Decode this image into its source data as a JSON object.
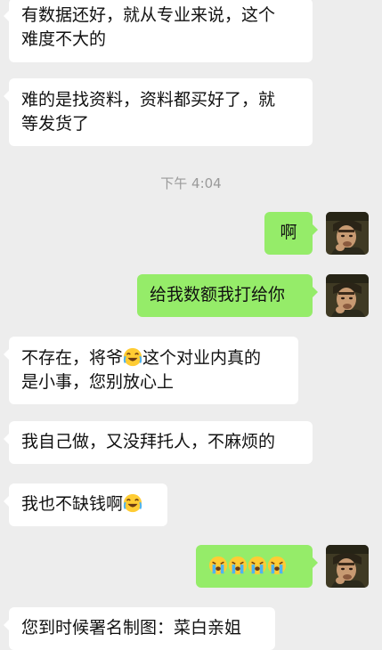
{
  "timestamp": "下午 4:04",
  "messages": {
    "m1": {
      "line1": "有数据还好，就从专业来说，这个",
      "line2": "难度不大的"
    },
    "m2": {
      "line1": "难的是找资料，资料都买好了，就",
      "line2": "等发货了"
    },
    "m3": {
      "text": "啊"
    },
    "m4": {
      "text": "给我数额我打给你"
    },
    "m5": {
      "line1_a": "不存在，将爷",
      "line1_b": "这个对业内真的",
      "line2": "是小事，您别放心上",
      "emoji": "laughing-crying-emoji"
    },
    "m6": {
      "text": "我自己做，又没拜托人，不麻烦的"
    },
    "m7": {
      "text": "我也不缺钱啊",
      "emoji": "laughing-crying-emoji"
    },
    "m8": {
      "emojis": [
        "crying-emoji",
        "crying-emoji",
        "crying-emoji",
        "crying-emoji"
      ]
    },
    "m9": {
      "text": "您到时候署名制图：菜白亲姐"
    }
  },
  "colors": {
    "background": "#ededed",
    "incoming_bubble": "#ffffff",
    "outgoing_bubble": "#95ec69",
    "timestamp_text": "#9a9a9a"
  },
  "avatar_icon": "user-avatar-photo"
}
